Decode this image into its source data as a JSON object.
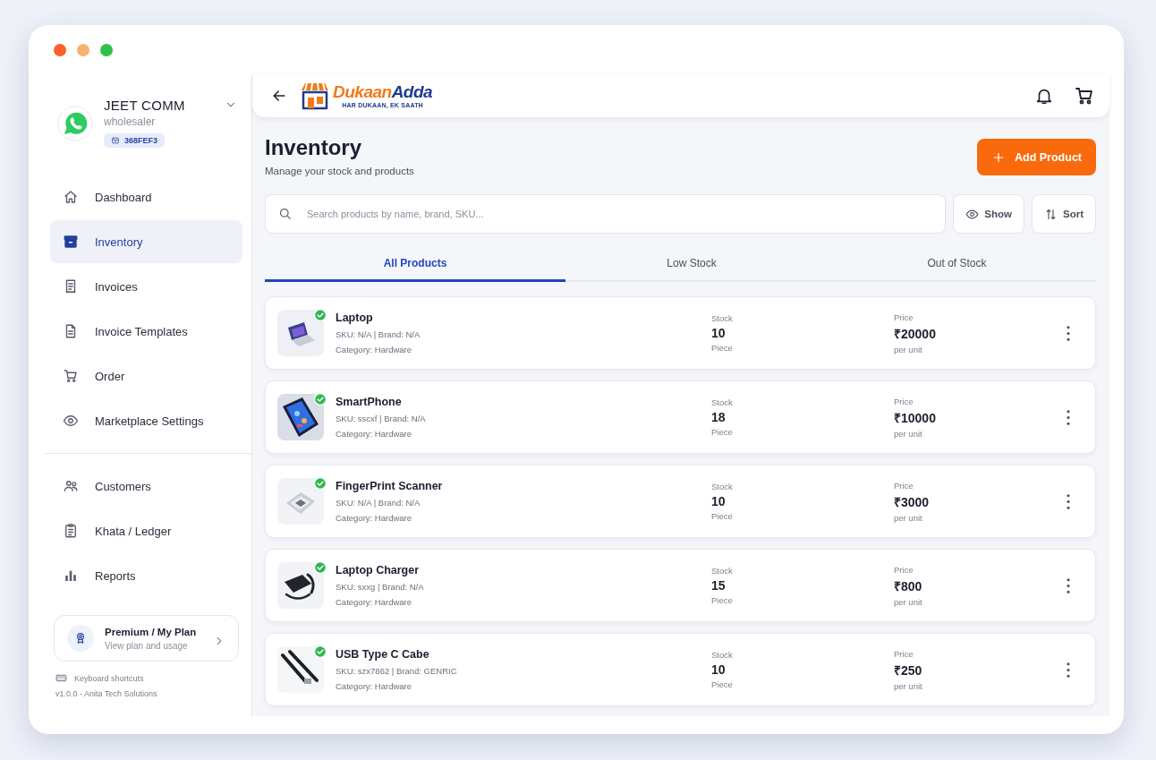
{
  "account": {
    "name": "JEET COMM",
    "role": "wholesaler",
    "code": "368FEF3"
  },
  "sidebar": {
    "groups": [
      [
        {
          "label": "Dashboard",
          "selected": false
        },
        {
          "label": "Inventory",
          "selected": true
        },
        {
          "label": "Invoices",
          "selected": false
        },
        {
          "label": "Invoice Templates",
          "selected": false
        },
        {
          "label": "Order",
          "selected": false
        },
        {
          "label": "Marketplace Settings",
          "selected": false
        }
      ],
      [
        {
          "label": "Customers",
          "selected": false
        },
        {
          "label": "Khata / Ledger",
          "selected": false
        },
        {
          "label": "Reports",
          "selected": false
        }
      ]
    ],
    "plan": {
      "title": "Premium / My Plan",
      "subtitle": "View plan and usage"
    },
    "shortcuts": "Keyboard shortcuts",
    "version": "v1.0.0 - Anita Tech Solutions"
  },
  "header": {
    "logo": {
      "first": "Dukaan",
      "second": "Adda",
      "tagline": "HAR DUKAAN, EK SAATH"
    }
  },
  "page": {
    "title": "Inventory",
    "subtitle": "Manage your stock and products",
    "add_button": "Add Product"
  },
  "search": {
    "placeholder": "Search products by name, brand, SKU..."
  },
  "toolbar": [
    "Show",
    "Sort"
  ],
  "tabs": [
    {
      "label": "All Products",
      "selected": true
    },
    {
      "label": "Low Stock",
      "selected": false
    },
    {
      "label": "Out of Stock",
      "selected": false
    }
  ],
  "products": [
    {
      "name": "Laptop",
      "meta": "SKU: N/A | Brand: N/A",
      "category": "Category: Hardware",
      "stock_label": "Stock",
      "stock": "10",
      "unit": "Piece",
      "price_label": "Price",
      "price": "₹20000",
      "per": "per unit",
      "verified": true
    },
    {
      "name": "SmartPhone",
      "meta": "SKU: sscxf | Brand: N/A",
      "category": "Category: Hardware",
      "stock_label": "Stock",
      "stock": "18",
      "unit": "Piece",
      "price_label": "Price",
      "price": "₹10000",
      "per": "per unit",
      "verified": true
    },
    {
      "name": "FingerPrint Scanner",
      "meta": "SKU: N/A | Brand: N/A",
      "category": "Category: Hardware",
      "stock_label": "Stock",
      "stock": "10",
      "unit": "Piece",
      "price_label": "Price",
      "price": "₹3000",
      "per": "per unit",
      "verified": true
    },
    {
      "name": "Laptop Charger",
      "meta": "SKU: sxxg | Brand: N/A",
      "category": "Category: Hardware",
      "stock_label": "Stock",
      "stock": "15",
      "unit": "Piece",
      "price_label": "Price",
      "price": "₹800",
      "per": "per unit",
      "verified": true
    },
    {
      "name": "USB Type C Cabe",
      "meta": "SKU: szx7862 | Brand: GENRIC",
      "category": "Category: Hardware",
      "stock_label": "Stock",
      "stock": "10",
      "unit": "Piece",
      "price_label": "Price",
      "price": "₹250",
      "per": "per unit",
      "verified": true
    }
  ]
}
